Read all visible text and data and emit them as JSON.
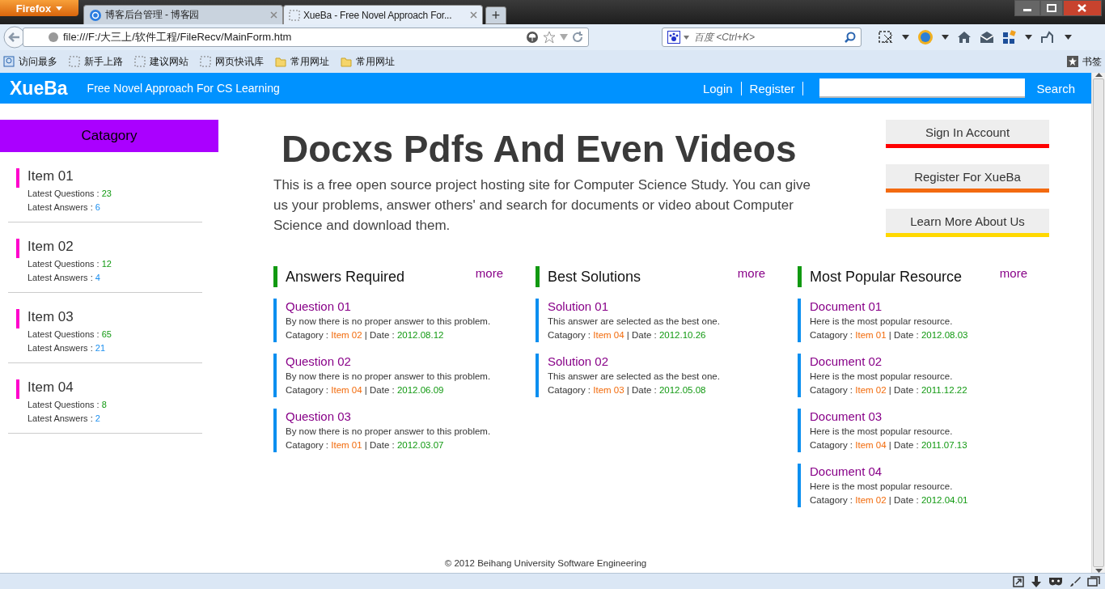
{
  "browser": {
    "menu_button": "Firefox",
    "tabs": [
      {
        "title": "博客后台管理 - 博客园",
        "selected": false
      },
      {
        "title": "XueBa - Free Novel Approach For...",
        "selected": true
      }
    ],
    "new_tab": "+",
    "url": "file:///F:/大三上/软件工程/FileRecv/MainForm.htm",
    "search_placeholder": "百度 <Ctrl+K>",
    "bookmarks": [
      {
        "label": "访问最多",
        "kind": "special"
      },
      {
        "label": "新手上路",
        "kind": "page"
      },
      {
        "label": "建议网站",
        "kind": "page"
      },
      {
        "label": "网页快讯库",
        "kind": "page"
      },
      {
        "label": "常用网址",
        "kind": "folder"
      },
      {
        "label": "常用网址",
        "kind": "folder"
      }
    ],
    "bookmarks_menu": "书签"
  },
  "site": {
    "logo": "XueBa",
    "tagline": "Free Novel Approach For CS Learning",
    "nav": [
      "Login",
      "Register"
    ],
    "search_button": "Search"
  },
  "sidebar": {
    "title": "Catagory",
    "items": [
      {
        "name": "Item 01",
        "questions_label": "Latest Questions :",
        "questions": "23",
        "answers_label": "Latest Answers :",
        "answers": "6"
      },
      {
        "name": "Item 02",
        "questions_label": "Latest Questions :",
        "questions": "12",
        "answers_label": "Latest Answers :",
        "answers": "4"
      },
      {
        "name": "Item 03",
        "questions_label": "Latest Questions :",
        "questions": "65",
        "answers_label": "Latest Answers :",
        "answers": "21"
      },
      {
        "name": "Item 04",
        "questions_label": "Latest Questions :",
        "questions": "8",
        "answers_label": "Latest Answers :",
        "answers": "2"
      }
    ]
  },
  "hero": {
    "title": "Docxs Pdfs And Even Videos",
    "text": "This is a free open source project hosting site for Computer Science Study. You can give us your problems, answer others' and search for documents or video about Computer Science and download them."
  },
  "actions": [
    {
      "label": "Sign In Account",
      "color": "#ff0000"
    },
    {
      "label": "Register For XueBa",
      "color": "#f36a10"
    },
    {
      "label": "Learn More About Us",
      "color": "#ffd800"
    }
  ],
  "sections": [
    {
      "title": "Answers Required",
      "more": "more",
      "items": [
        {
          "title": "Question 01",
          "text": "By now there is no proper answer to this problem.",
          "category_label": "Catagory :",
          "category": "Item 02",
          "separator": "|",
          "date_label": "Date :",
          "date": "2012.08.12"
        },
        {
          "title": "Question 02",
          "text": "By now there is no proper answer to this problem.",
          "category_label": "Catagory :",
          "category": "Item 04",
          "separator": "|",
          "date_label": "Date :",
          "date": "2012.06.09"
        },
        {
          "title": "Question 03",
          "text": "By now there is no proper answer to this problem.",
          "category_label": "Catagory :",
          "category": "Item 01",
          "separator": "|",
          "date_label": "Date :",
          "date": "2012.03.07"
        }
      ]
    },
    {
      "title": "Best Solutions",
      "more": "more",
      "items": [
        {
          "title": "Solution 01",
          "text": "This answer are selected as the best one.",
          "category_label": "Catagory :",
          "category": "Item 04",
          "separator": "|",
          "date_label": "Date :",
          "date": "2012.10.26"
        },
        {
          "title": "Solution 02",
          "text": "This answer are selected as the best one.",
          "category_label": "Catagory :",
          "category": "Item 03",
          "separator": "|",
          "date_label": "Date :",
          "date": "2012.05.08"
        }
      ]
    },
    {
      "title": "Most Popular Resource",
      "more": "more",
      "items": [
        {
          "title": "Document 01",
          "text": "Here is the most popular resource.",
          "category_label": "Catagory :",
          "category": "Item 01",
          "separator": "|",
          "date_label": "Date :",
          "date": "2012.08.03"
        },
        {
          "title": "Document 02",
          "text": "Here is the most popular resource.",
          "category_label": "Catagory :",
          "category": "Item 02",
          "separator": "|",
          "date_label": "Date :",
          "date": "2011.12.22"
        },
        {
          "title": "Document 03",
          "text": "Here is the most popular resource.",
          "category_label": "Catagory :",
          "category": "Item 04",
          "separator": "|",
          "date_label": "Date :",
          "date": "2011.07.13"
        },
        {
          "title": "Document 04",
          "text": "Here is the most popular resource.",
          "category_label": "Catagory :",
          "category": "Item 02",
          "separator": "|",
          "date_label": "Date :",
          "date": "2012.04.01"
        }
      ]
    }
  ],
  "footer": "© 2012 Beihang University Software Engineering"
}
